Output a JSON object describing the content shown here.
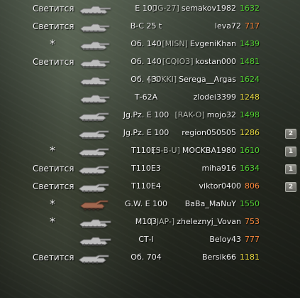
{
  "colors": {
    "green": "#53d233",
    "yellow": "#e5d640",
    "orange": "#ff8a3d"
  },
  "rows": [
    {
      "label": "Светится",
      "tank_name": "E 100",
      "clan": "[IG-27]",
      "player": "semakov1982",
      "rating": "1632",
      "rating_color": "#53d233",
      "squad": "",
      "icon": "heavy-tank-icon",
      "tank_color": "#bcbcbc"
    },
    {
      "label": "Светится",
      "tank_name": "В-С 25 t",
      "clan": "",
      "player": "leva72",
      "rating": "717",
      "rating_color": "#ff8a3d",
      "squad": "",
      "icon": "medium-tank-icon",
      "tank_color": "#bcbcbc"
    },
    {
      "label": "*",
      "tank_name": "Об. 140",
      "clan": "[MISN]",
      "player": "EvgeniKhan",
      "rating": "1439",
      "rating_color": "#53d233",
      "squad": "",
      "icon": "medium-tank-icon",
      "tank_color": "#bcbcbc"
    },
    {
      "label": "Светится",
      "tank_name": "Об. 140",
      "clan": "[CQIO3]",
      "player": "kostan000",
      "rating": "1481",
      "rating_color": "#53d233",
      "squad": "",
      "icon": "medium-tank-icon",
      "tank_color": "#bcbcbc"
    },
    {
      "label": "",
      "tank_name": "Об. 430",
      "clan": "[LOKKI]",
      "player": "Serega__Argas",
      "rating": "1624",
      "rating_color": "#53d233",
      "squad": "",
      "icon": "medium-tank-icon",
      "tank_color": "#bcbcbc"
    },
    {
      "label": "",
      "tank_name": "Т-62А",
      "clan": "",
      "player": "zlodei3399",
      "rating": "1248",
      "rating_color": "#e5d640",
      "squad": "",
      "icon": "medium-tank-icon",
      "tank_color": "#bcbcbc"
    },
    {
      "label": "",
      "tank_name": "Jg.Pz. E 100",
      "clan": "[RAK-O]",
      "player": "mojo32",
      "rating": "1498",
      "rating_color": "#53d233",
      "squad": "",
      "icon": "tank-destroyer-icon",
      "tank_color": "#bcbcbc"
    },
    {
      "label": "",
      "tank_name": "Jg.Pz. E 100",
      "clan": "",
      "player": "region050505",
      "rating": "1286",
      "rating_color": "#e5d640",
      "squad": "2",
      "icon": "tank-destroyer-icon",
      "tank_color": "#bcbcbc"
    },
    {
      "label": "*",
      "tank_name": "T110E3",
      "clan": "[S-B-U]",
      "player": "MOCKBA1980",
      "rating": "1610",
      "rating_color": "#53d233",
      "squad": "1",
      "icon": "tank-destroyer-icon",
      "tank_color": "#bcbcbc"
    },
    {
      "label": "Светится",
      "tank_name": "T110E3",
      "clan": "",
      "player": "miha916",
      "rating": "1634",
      "rating_color": "#53d233",
      "squad": "1",
      "icon": "tank-destroyer-icon",
      "tank_color": "#bcbcbc"
    },
    {
      "label": "Светится",
      "tank_name": "T110E4",
      "clan": "",
      "player": "viktor0400",
      "rating": "806",
      "rating_color": "#ff8a3d",
      "squad": "2",
      "icon": "tank-destroyer-icon",
      "tank_color": "#bcbcbc"
    },
    {
      "label": "*",
      "tank_name": "G.W. E 100",
      "clan": "",
      "player": "BaBa_MaNuY",
      "rating": "1550",
      "rating_color": "#53d233",
      "squad": "",
      "icon": "artillery-icon",
      "tank_color": "#a2674f"
    },
    {
      "label": "*",
      "tank_name": "M103",
      "clan": "[-JAP-]",
      "player": "zheleznyj_Vovan",
      "rating": "753",
      "rating_color": "#ff8a3d",
      "squad": "",
      "icon": "heavy-tank-icon",
      "tank_color": "#bcbcbc"
    },
    {
      "label": "",
      "tank_name": "СТ-I",
      "clan": "",
      "player": "Beloy43",
      "rating": "777",
      "rating_color": "#ff8a3d",
      "squad": "",
      "icon": "heavy-tank-icon",
      "tank_color": "#bcbcbc"
    },
    {
      "label": "Светится",
      "tank_name": "Об. 704",
      "clan": "",
      "player": "Bersik66",
      "rating": "1181",
      "rating_color": "#e5d640",
      "squad": "",
      "icon": "tank-destroyer-icon",
      "tank_color": "#bcbcbc"
    }
  ]
}
